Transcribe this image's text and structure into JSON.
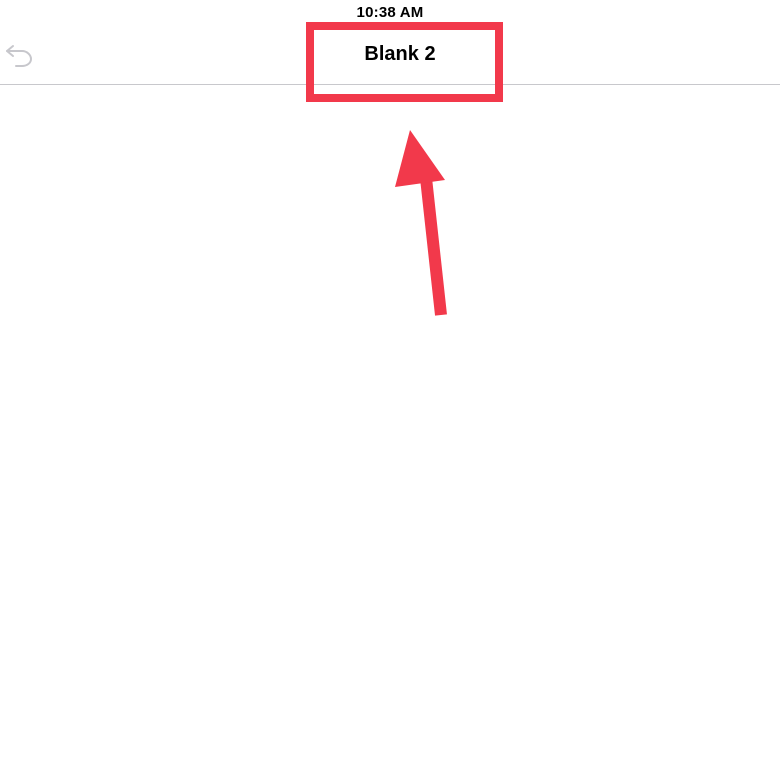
{
  "status_bar": {
    "time": "10:38 AM"
  },
  "nav_bar": {
    "document_title": "Blank 2",
    "undo_icon": "undo-arrow-icon"
  },
  "annotation": {
    "color": "#f2394b",
    "highlight_target": "document-title"
  }
}
